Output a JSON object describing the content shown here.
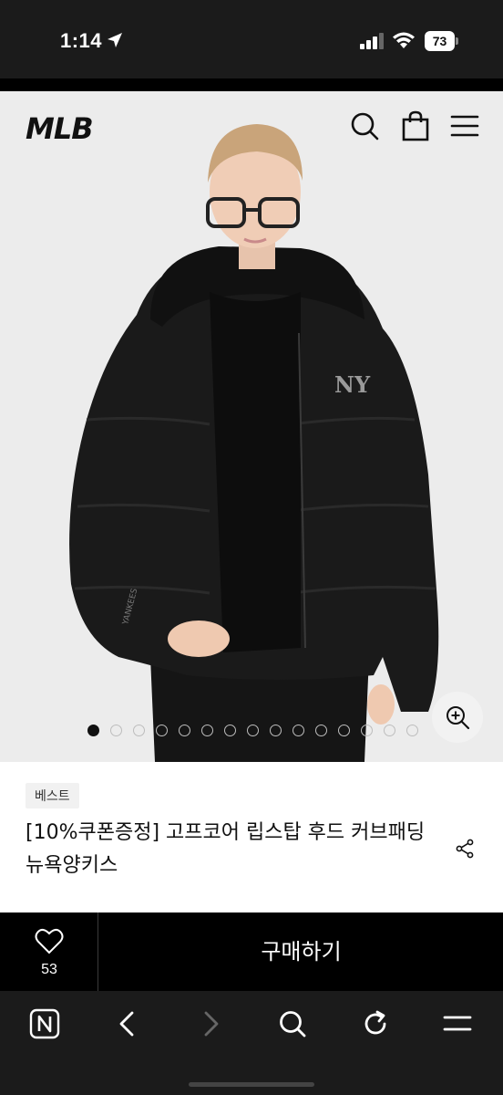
{
  "status": {
    "time": "1:14",
    "battery": "73",
    "icons": [
      "location-arrow-icon",
      "cellular-signal-icon",
      "wifi-icon",
      "battery-icon"
    ]
  },
  "header": {
    "brand": "MLB",
    "icons": [
      "search-icon",
      "shopping-bag-icon",
      "hamburger-menu-icon"
    ]
  },
  "gallery": {
    "image": "product-photo-black-hooded-puffer-jacket",
    "slide_count": 15,
    "active_slide": 1,
    "zoom_icon": "zoom-in-icon"
  },
  "product": {
    "badge": "베스트",
    "title": "[10%쿠폰증정] 고프코어 립스탑 후드 커브패딩 뉴욕양키스",
    "share_icon": "share-icon"
  },
  "purchase": {
    "like_count": "53",
    "buy_label": "구매하기",
    "heart_icon": "heart-icon"
  },
  "browser": {
    "icons": [
      "naver-home-icon",
      "back-arrow-icon",
      "forward-arrow-icon",
      "search-icon",
      "refresh-icon",
      "menu-icon"
    ]
  },
  "colors": {
    "dark_bar": "#1b1b1b",
    "black": "#000000",
    "hero_bg": "#ececec",
    "accent_text": "#111111"
  }
}
